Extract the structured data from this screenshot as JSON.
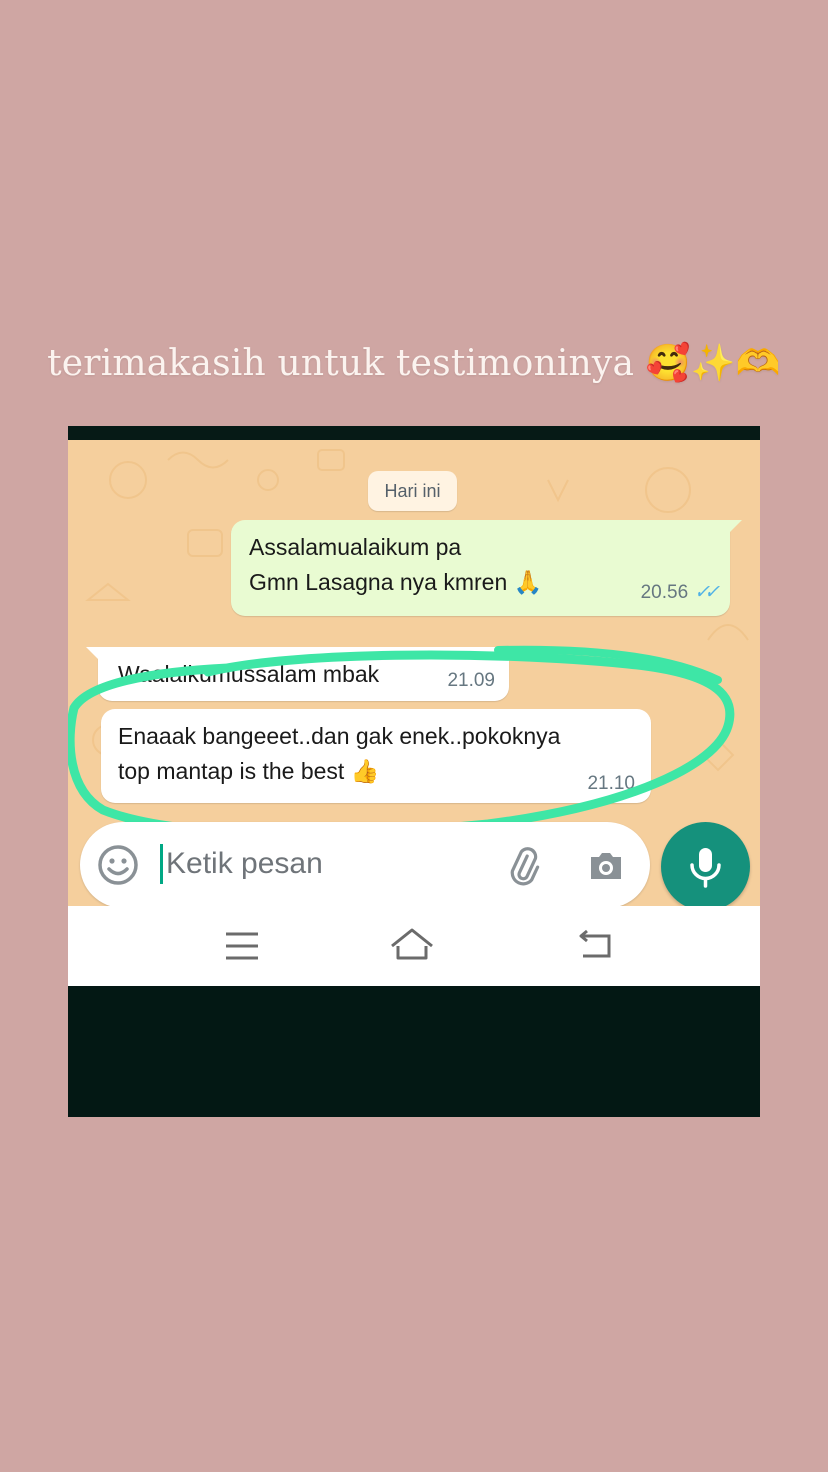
{
  "story": {
    "caption": "terimakasih untuk testimoninya 🥰✨🫶"
  },
  "chat": {
    "date_label": "Hari ini",
    "messages": [
      {
        "direction": "outgoing",
        "lines": [
          "Assalamualaikum pa",
          "Gmn  Lasagna nya  kmren 🙏"
        ],
        "time": "20.56",
        "status": "read"
      },
      {
        "direction": "incoming",
        "lines": [
          "Waalaikumussalam mbak"
        ],
        "time": "21.09"
      },
      {
        "direction": "incoming",
        "lines": [
          "Enaaak bangeeet..dan gak enek..pokoknya",
          "top mantap is the best 👍"
        ],
        "time": "21.10",
        "highlighted": true
      }
    ]
  },
  "composer": {
    "placeholder": "Ketik pesan",
    "emoji_icon": "smiley-icon",
    "attach_icon": "paperclip-icon",
    "camera_icon": "camera-icon",
    "mic_icon": "microphone-icon"
  },
  "navbar": {
    "icons": [
      "menu-icon",
      "home-icon",
      "back-icon"
    ]
  },
  "colors": {
    "story_background": "#cfa6a3",
    "chat_wallpaper": "#f5cf9d",
    "outgoing_bubble": "#e9fbd2",
    "incoming_bubble": "#ffffff",
    "highlight_circle": "#3ee6a6",
    "mic_button": "#15917c",
    "read_ticks": "#4fb1e6"
  }
}
